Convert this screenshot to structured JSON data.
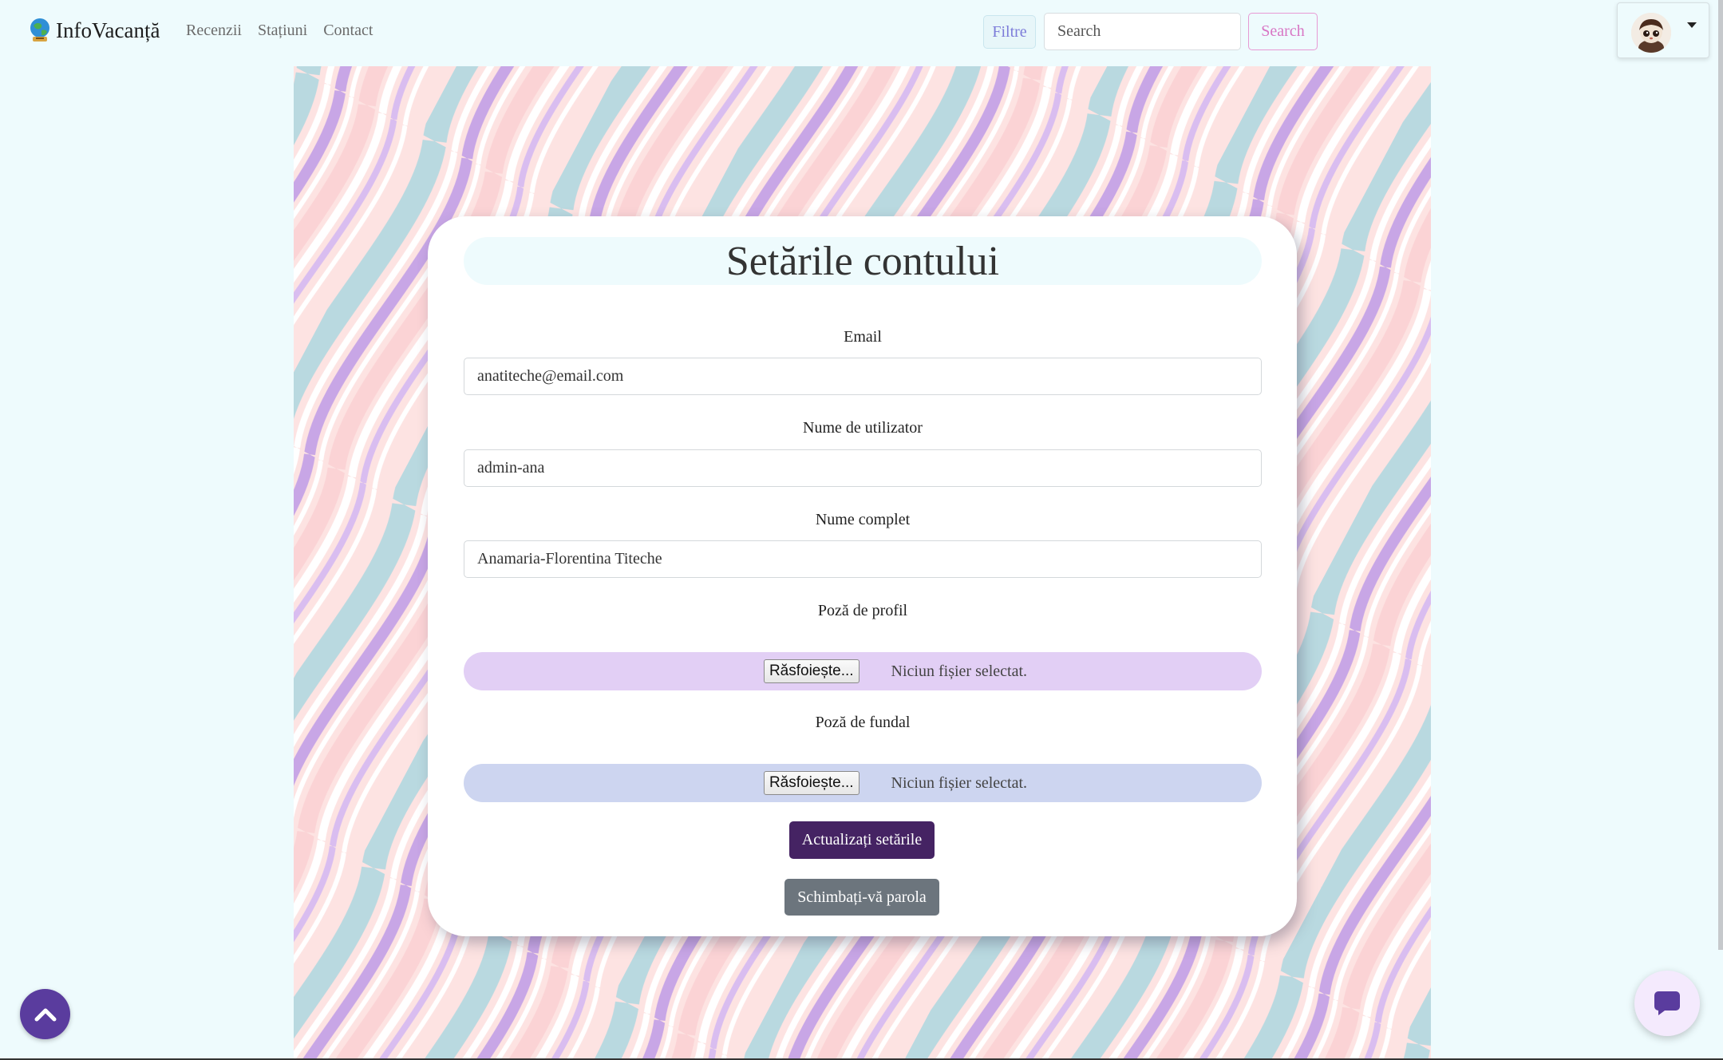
{
  "navbar": {
    "brand": "InfoVacanță",
    "links": [
      "Recenzii",
      "Stațiuni",
      "Contact"
    ],
    "filter_label": "Filtre",
    "search_placeholder": "Search",
    "search_label": "Search"
  },
  "card": {
    "title": "Setările contului",
    "email": {
      "label": "Email",
      "value": "anatiteche@email.com"
    },
    "username": {
      "label": "Nume de utilizator",
      "value": "admin-ana"
    },
    "fullname": {
      "label": "Nume complet",
      "value": "Anamaria-Florentina Titeche"
    },
    "profile_pic": {
      "label": "Poză de profil",
      "button": "Răsfoiește...",
      "status": "Niciun fișier selectat."
    },
    "background_pic": {
      "label": "Poză de fundal",
      "button": "Răsfoiește...",
      "status": "Niciun fișier selectat."
    },
    "update_label": "Actualizați setările",
    "password_label": "Schimbați-vă parola"
  },
  "colors": {
    "page_bg": "#eefbfd",
    "update_button": "#452363",
    "password_button": "#6c757d",
    "scroll_top": "#5a3c9e",
    "search_accent": "#d875c4",
    "filter_accent": "#7c7bd9"
  },
  "icons": {
    "brand": "globe-logo-icon",
    "scroll_top": "chevron-up-icon",
    "chat": "chat-bubble-icon",
    "dropdown": "caret-down-icon"
  }
}
